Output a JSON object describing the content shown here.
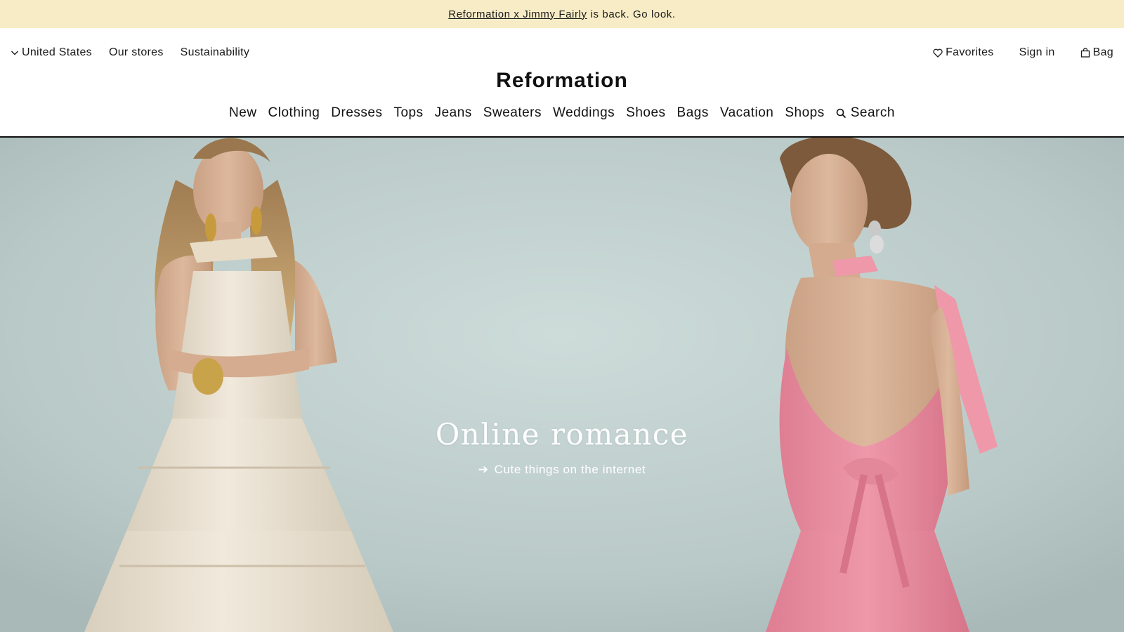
{
  "promo": {
    "link_text": "Reformation x Jimmy Fairly",
    "rest_text": "is back. Go look."
  },
  "utility_nav": {
    "region": "United States",
    "stores": "Our stores",
    "sustainability": "Sustainability",
    "favorites": "Favorites",
    "sign_in": "Sign in",
    "bag": "Bag"
  },
  "brand": {
    "name": "Reformation"
  },
  "main_nav": {
    "items": [
      {
        "label": "New"
      },
      {
        "label": "Clothing"
      },
      {
        "label": "Dresses"
      },
      {
        "label": "Tops"
      },
      {
        "label": "Jeans"
      },
      {
        "label": "Sweaters"
      },
      {
        "label": "Weddings"
      },
      {
        "label": "Shoes"
      },
      {
        "label": "Bags"
      },
      {
        "label": "Vacation"
      },
      {
        "label": "Shops"
      }
    ],
    "search_label": "Search"
  },
  "hero": {
    "title": "Online romance",
    "cta": "Cute things on the internet",
    "cta_icon": "arrow-right-icon"
  },
  "colors": {
    "promo_bg": "#f8ecc6",
    "hero_bg": "#bccccb",
    "ivory_dress": "#e8ddc8",
    "pink_dress": "#e8899c"
  }
}
